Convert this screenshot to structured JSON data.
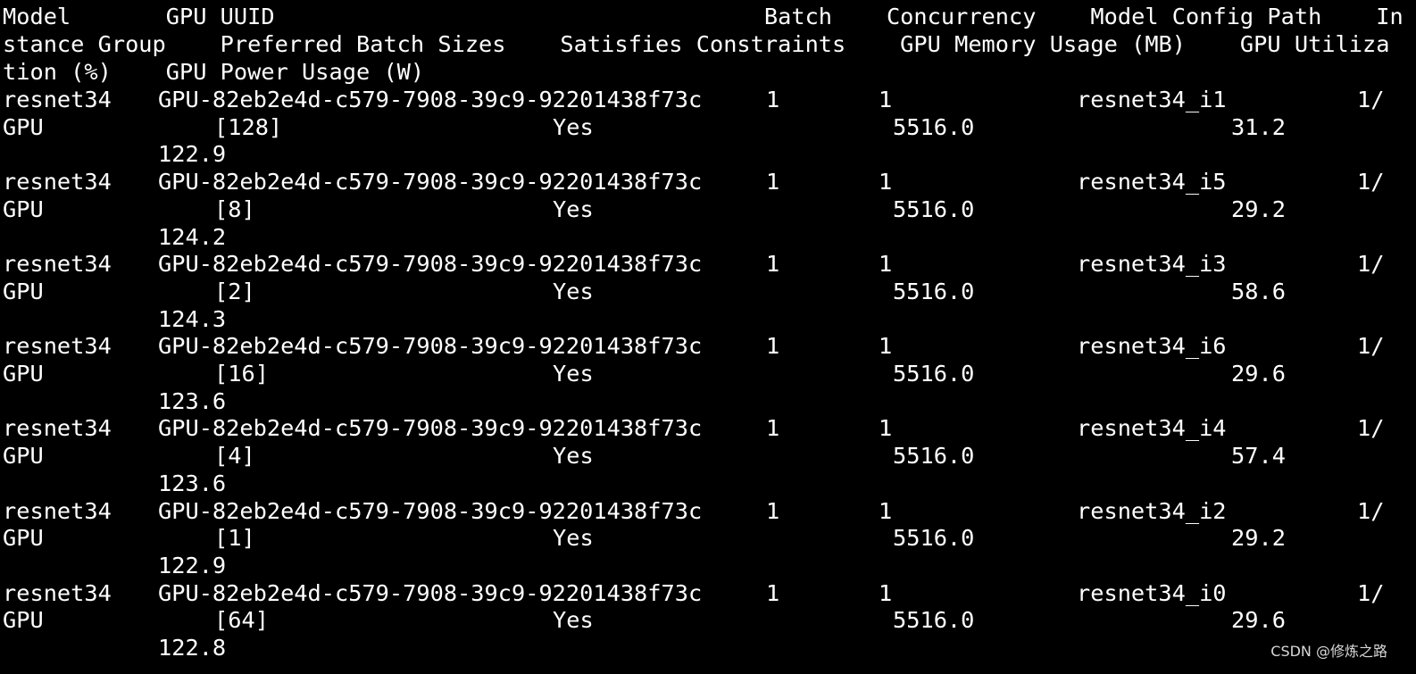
{
  "header": {
    "lines": [
      "Model       GPU UUID                                    Batch    Concurrency    Model Config Path    In",
      "stance Group    Preferred Batch Sizes    Satisfies Constraints    GPU Memory Usage (MB)    GPU Utiliza",
      "tion (%)    GPU Power Usage (W)"
    ]
  },
  "rows": [
    {
      "model": "resnet34",
      "gpu_uuid": "GPU-82eb2e4d-c579-7908-39c9-92201438f73c",
      "batch": "1",
      "concurrency": "1",
      "model_config_path": "resnet34_i1",
      "instance_group_part1": "1/",
      "instance_group_part2": "GPU",
      "preferred_batch_sizes": "[128]",
      "satisfies_constraints": "Yes",
      "gpu_memory_usage_mb": "5516.0",
      "gpu_utilization_pct": "31.2",
      "gpu_power_usage_w": "122.9"
    },
    {
      "model": "resnet34",
      "gpu_uuid": "GPU-82eb2e4d-c579-7908-39c9-92201438f73c",
      "batch": "1",
      "concurrency": "1",
      "model_config_path": "resnet34_i5",
      "instance_group_part1": "1/",
      "instance_group_part2": "GPU",
      "preferred_batch_sizes": "[8]",
      "satisfies_constraints": "Yes",
      "gpu_memory_usage_mb": "5516.0",
      "gpu_utilization_pct": "29.2",
      "gpu_power_usage_w": "124.2"
    },
    {
      "model": "resnet34",
      "gpu_uuid": "GPU-82eb2e4d-c579-7908-39c9-92201438f73c",
      "batch": "1",
      "concurrency": "1",
      "model_config_path": "resnet34_i3",
      "instance_group_part1": "1/",
      "instance_group_part2": "GPU",
      "preferred_batch_sizes": "[2]",
      "satisfies_constraints": "Yes",
      "gpu_memory_usage_mb": "5516.0",
      "gpu_utilization_pct": "58.6",
      "gpu_power_usage_w": "124.3"
    },
    {
      "model": "resnet34",
      "gpu_uuid": "GPU-82eb2e4d-c579-7908-39c9-92201438f73c",
      "batch": "1",
      "concurrency": "1",
      "model_config_path": "resnet34_i6",
      "instance_group_part1": "1/",
      "instance_group_part2": "GPU",
      "preferred_batch_sizes": "[16]",
      "satisfies_constraints": "Yes",
      "gpu_memory_usage_mb": "5516.0",
      "gpu_utilization_pct": "29.6",
      "gpu_power_usage_w": "123.6"
    },
    {
      "model": "resnet34",
      "gpu_uuid": "GPU-82eb2e4d-c579-7908-39c9-92201438f73c",
      "batch": "1",
      "concurrency": "1",
      "model_config_path": "resnet34_i4",
      "instance_group_part1": "1/",
      "instance_group_part2": "GPU",
      "preferred_batch_sizes": "[4]",
      "satisfies_constraints": "Yes",
      "gpu_memory_usage_mb": "5516.0",
      "gpu_utilization_pct": "57.4",
      "gpu_power_usage_w": "123.6"
    },
    {
      "model": "resnet34",
      "gpu_uuid": "GPU-82eb2e4d-c579-7908-39c9-92201438f73c",
      "batch": "1",
      "concurrency": "1",
      "model_config_path": "resnet34_i2",
      "instance_group_part1": "1/",
      "instance_group_part2": "GPU",
      "preferred_batch_sizes": "[1]",
      "satisfies_constraints": "Yes",
      "gpu_memory_usage_mb": "5516.0",
      "gpu_utilization_pct": "29.2",
      "gpu_power_usage_w": "122.9"
    },
    {
      "model": "resnet34",
      "gpu_uuid": "GPU-82eb2e4d-c579-7908-39c9-92201438f73c",
      "batch": "1",
      "concurrency": "1",
      "model_config_path": "resnet34_i0",
      "instance_group_part1": "1/",
      "instance_group_part2": "GPU",
      "preferred_batch_sizes": "[64]",
      "satisfies_constraints": "Yes",
      "gpu_memory_usage_mb": "5516.0",
      "gpu_utilization_pct": "29.6",
      "gpu_power_usage_w": "122.8"
    }
  ],
  "watermark": "CSDN @修炼之路"
}
